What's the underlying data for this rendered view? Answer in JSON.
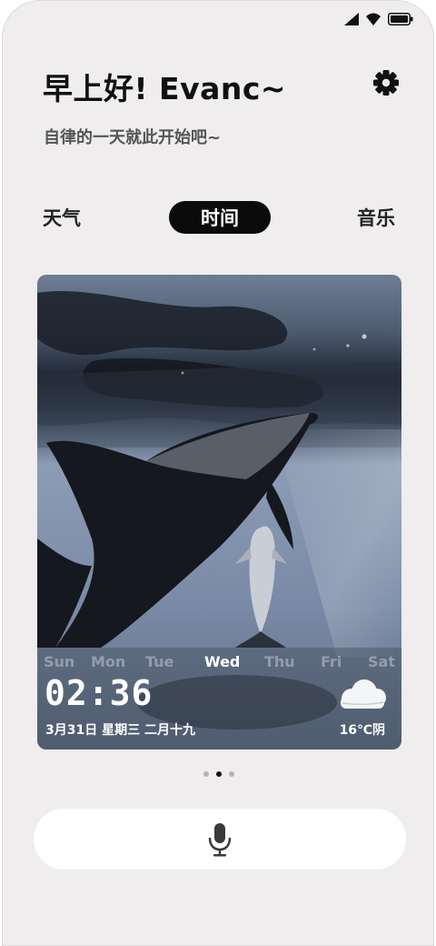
{
  "header": {
    "greeting": "早上好! Evanc~",
    "subtitle": "自律的一天就此开始吧~"
  },
  "tabs": [
    {
      "label": "天气",
      "active": false
    },
    {
      "label": "时间",
      "active": true
    },
    {
      "label": "音乐",
      "active": false
    }
  ],
  "card": {
    "days": [
      "Sun",
      "Mon",
      "Tue",
      "Wed",
      "Thu",
      "Fri",
      "Sat"
    ],
    "active_day": "Wed",
    "time": "02:36",
    "date": "3月31日 星期三 二月十九",
    "weather": "16℃阴",
    "weather_icon": "cloud-icon"
  },
  "pager": {
    "count": 3,
    "active_index": 1
  },
  "icons": {
    "settings": "gear-icon",
    "voice": "microphone-icon",
    "status": [
      "signal-icon",
      "wifi-icon",
      "battery-icon"
    ]
  },
  "colors": {
    "background": "#efedee",
    "active_tab": "#0b0b0b",
    "text": "#111111",
    "subtitle": "#555555"
  }
}
